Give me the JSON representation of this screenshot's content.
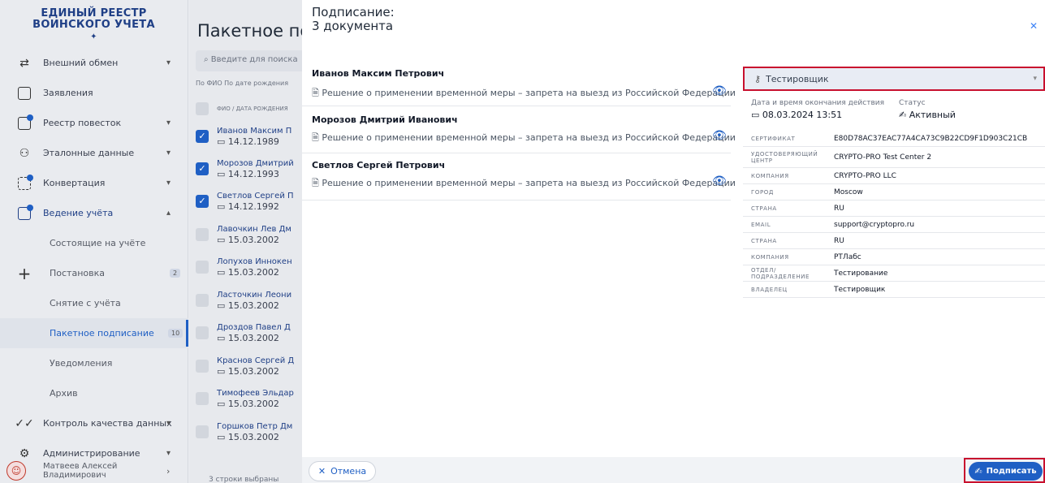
{
  "sidebar": {
    "logo_line1": "ЕДИНЫЙ РЕЕСТР",
    "logo_line2": "ВОИНСКОГО УЧЕТА",
    "items": [
      {
        "label": "Внешний обмен",
        "icon": "exchange-icon"
      },
      {
        "label": "Заявления",
        "icon": "document-icon"
      },
      {
        "label": "Реестр повесток",
        "icon": "register-icon"
      },
      {
        "label": "Эталонные данные",
        "icon": "people-icon"
      },
      {
        "label": "Конвертация",
        "icon": "convert-icon"
      },
      {
        "label": "Ведение учёта",
        "icon": "accounting-icon"
      },
      {
        "label": "Состоящие на учёте"
      },
      {
        "label": "Постановка",
        "badge": "2"
      },
      {
        "label": "Снятие с учёта"
      },
      {
        "label": "Пакетное подписание",
        "badge": "10"
      },
      {
        "label": "Уведомления"
      },
      {
        "label": "Архив"
      },
      {
        "label": "Контроль качества данных",
        "icon": "check-icon"
      },
      {
        "label": "Администрирование",
        "icon": "settings-icon"
      }
    ],
    "user_name": "Матвеев Алексей Владимирович"
  },
  "middle": {
    "title": "Пакетное подписание",
    "search_placeholder": "Введите для поиска",
    "filters": "По ФИО   По дате рождения",
    "col_header": "ФИО / ДАТА РОЖДЕНИЯ",
    "rows": [
      {
        "name": "Иванов Максим П",
        "date": "14.12.1989",
        "checked": true
      },
      {
        "name": "Морозов Дмитрий",
        "date": "14.12.1993",
        "checked": true
      },
      {
        "name": "Светлов Сергей П",
        "date": "14.12.1992",
        "checked": true
      },
      {
        "name": "Лавочкин Лев Дм",
        "date": "15.03.2002",
        "checked": false
      },
      {
        "name": "Лопухов Иннокен",
        "date": "15.03.2002",
        "checked": false
      },
      {
        "name": "Ласточкин Леони",
        "date": "15.03.2002",
        "checked": false
      },
      {
        "name": "Дроздов Павел Д",
        "date": "15.03.2002",
        "checked": false
      },
      {
        "name": "Краснов Сергей Д",
        "date": "15.03.2002",
        "checked": false
      },
      {
        "name": "Тимофеев Эльдар",
        "date": "15.03.2002",
        "checked": false
      },
      {
        "name": "Горшков Петр Дм",
        "date": "15.03.2002",
        "checked": false
      }
    ],
    "footer": "3 строки выбраны"
  },
  "modal": {
    "title": "Подписание:",
    "subtitle": "3 документа",
    "docs": [
      {
        "name": "Иванов Максим Петрович",
        "desc": "Решение о применении временной меры – запрета на выезд из Российской Федерации"
      },
      {
        "name": "Морозов Дмитрий Иванович",
        "desc": "Решение о применении временной меры – запрета на выезд из Российской Федерации"
      },
      {
        "name": "Светлов Сергей Петрович",
        "desc": "Решение о применении временной меры – запрета на выезд из Российской Федерации"
      }
    ],
    "cert": {
      "selected": "Тестировщик",
      "expiry_label": "Дата и время окончания действия",
      "expiry_value": "08.03.2024 13:51",
      "status_label": "Статус",
      "status_value": "Активный",
      "rows": [
        {
          "k": "СЕРТИФИКАТ",
          "v": "E80D78AC37EAC77A4CA73C9B22CD9F1D903C21CB"
        },
        {
          "k": "УДОСТОВЕРЯЮЩИЙ ЦЕНТР",
          "v": "CRYPTO-PRO Test Center 2"
        },
        {
          "k": "КОМПАНИЯ",
          "v": "CRYPTO-PRO LLC"
        },
        {
          "k": "ГОРОД",
          "v": "Moscow"
        },
        {
          "k": "СТРАНА",
          "v": "RU"
        },
        {
          "k": "EMAIL",
          "v": "support@cryptopro.ru"
        },
        {
          "k": "СТРАНА",
          "v": "RU"
        },
        {
          "k": "КОМПАНИЯ",
          "v": "РТЛабс"
        },
        {
          "k": "ОТДЕЛ/ПОДРАЗДЕЛЕНИЕ",
          "v": "Тестирование"
        },
        {
          "k": "ВЛАДЕЛЕЦ",
          "v": "Тестировщик"
        }
      ]
    },
    "cancel_label": "Отмена",
    "sign_label": "Подписать"
  }
}
